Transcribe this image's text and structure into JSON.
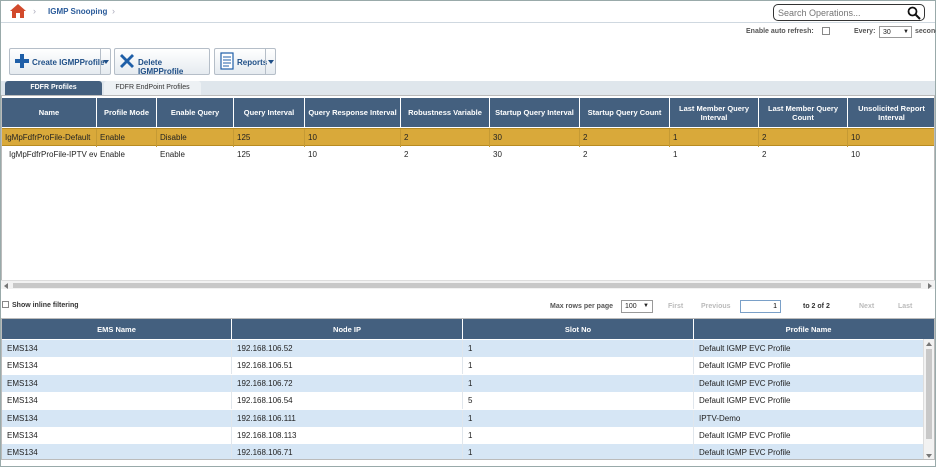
{
  "breadcrumb": {
    "section": "IGMP Snooping"
  },
  "search": {
    "placeholder": "Search Operations..."
  },
  "refresh": {
    "auto_label": "Enable auto refresh:",
    "every_label": "Every:",
    "interval": "30",
    "unit_label": "seconds"
  },
  "toolbar": {
    "create_label": "Create IGMPProfile",
    "delete_label": "Delete IGMPProfile",
    "reports_label": "Reports"
  },
  "tabs": [
    {
      "label": "FDFR Profiles",
      "active": true
    },
    {
      "label": "FDFR EndPoint Profiles",
      "active": false
    }
  ],
  "profiles_table": {
    "columns": [
      "Name",
      "Profile Mode",
      "Enable Query",
      "Query Interval",
      "Query Response Interval",
      "Robustness Variable",
      "Startup Query Interval",
      "Startup Query Count",
      "Last Member Query Interval",
      "Last Member Query Count",
      "Unsolicited Report Interval"
    ],
    "rows": [
      [
        "IgMpFdfrProFile-Default",
        "Enable",
        "Disable",
        "125",
        "10",
        "2",
        "30",
        "2",
        "1",
        "2",
        "10"
      ],
      [
        "IgMpFdfrProFile-IPTV ev",
        "Enable",
        "Enable",
        "125",
        "10",
        "2",
        "30",
        "2",
        "1",
        "2",
        "10"
      ]
    ],
    "selected_row": 0
  },
  "pager": {
    "inline_filter_label": "Show inline filtering",
    "max_rows_label": "Max rows per page",
    "max_rows": "100",
    "first": "First",
    "previous": "Previous",
    "page": "1",
    "range_text": "to 2 of 2",
    "next": "Next",
    "last": "Last"
  },
  "endpoint_table": {
    "columns": [
      "EMS Name",
      "Node IP",
      "Slot No",
      "Profile Name"
    ],
    "rows": [
      [
        "EMS134",
        "192.168.106.52",
        "1",
        "Default IGMP EVC Profile"
      ],
      [
        "EMS134",
        "192.168.106.51",
        "1",
        "Default IGMP EVC Profile"
      ],
      [
        "EMS134",
        "192.168.106.72",
        "1",
        "Default IGMP EVC Profile"
      ],
      [
        "EMS134",
        "192.168.106.54",
        "5",
        "Default IGMP EVC Profile"
      ],
      [
        "EMS134",
        "192.168.106.111",
        "1",
        "IPTV-Demo"
      ],
      [
        "EMS134",
        "192.168.108.113",
        "1",
        "Default IGMP EVC Profile"
      ],
      [
        "EMS134",
        "192.168.106.71",
        "1",
        "Default IGMP EVC Profile"
      ]
    ]
  },
  "colors": {
    "header": "#44607f",
    "selected_row": "#d9a93a",
    "alt_row": "#d6e6f5",
    "link": "#2a5b9a"
  }
}
